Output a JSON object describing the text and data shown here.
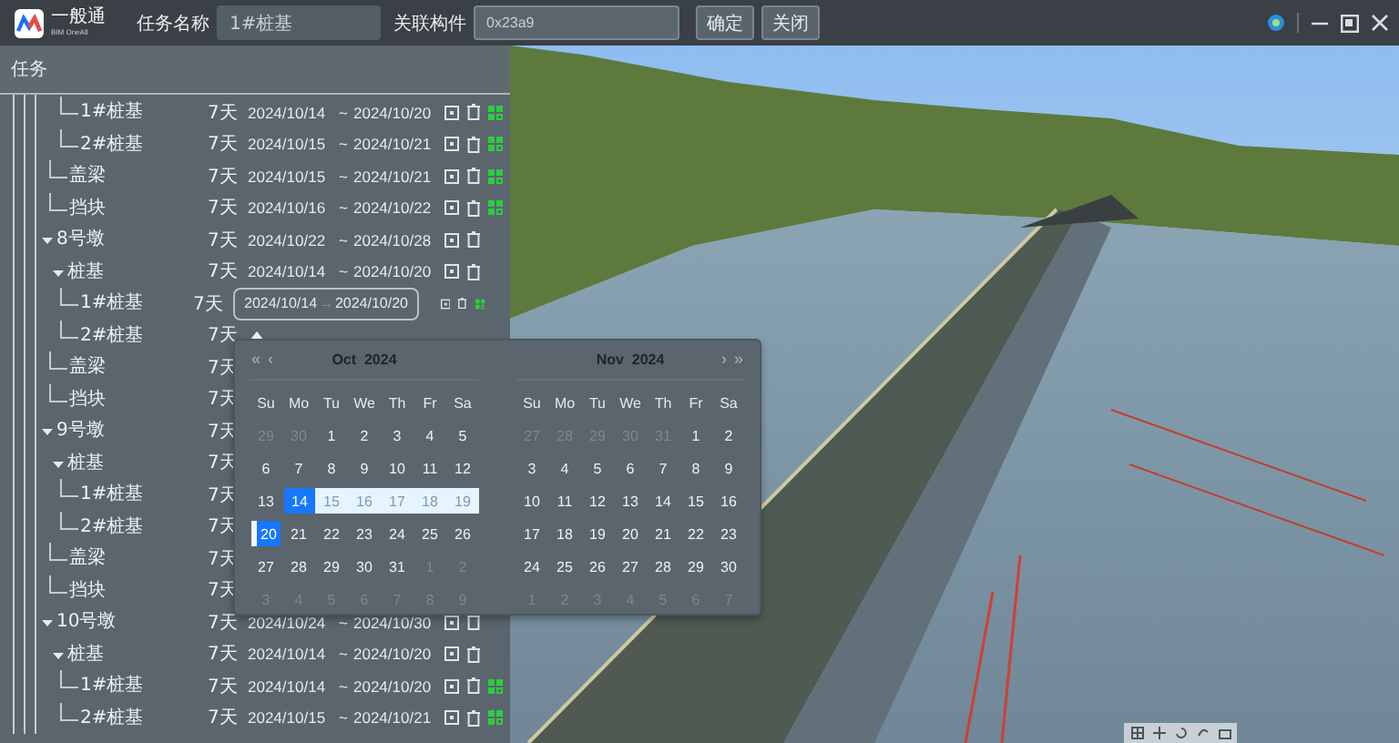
{
  "app": {
    "logo_text": "一般通",
    "logo_subtext": "BIM OneAll"
  },
  "toolbar": {
    "task_name_label": "任务名称",
    "task_name_value": "1#桩基",
    "component_label": "关联构件",
    "component_value": "0x23a9",
    "buttons": [
      "确定",
      "关闭"
    ]
  },
  "panel": {
    "title": "任务"
  },
  "tree": [
    {
      "children": [
        {
          "children": [
            {
              "label": "1#桩基",
              "duration": "7天",
              "start": "2024/10/14",
              "sep": "~",
              "end": "2024/10/20",
              "actions": true,
              "linked": true
            },
            {
              "label": "2#桩基",
              "duration": "7天",
              "start": "2024/10/15",
              "sep": "~",
              "end": "2024/10/21",
              "actions": true,
              "linked": true
            }
          ]
        },
        {
          "label": "盖梁",
          "duration": "7天",
          "start": "2024/10/15",
          "sep": "~",
          "end": "2024/10/21",
          "actions": true,
          "linked": true
        },
        {
          "label": "挡块",
          "duration": "7天",
          "start": "2024/10/16",
          "sep": "~",
          "end": "2024/10/22",
          "actions": true,
          "linked": true
        }
      ]
    },
    {
      "label": "8号墩",
      "expanded": true,
      "duration": "7天",
      "start": "2024/10/22",
      "sep": "~",
      "end": "2024/10/28",
      "actions": true,
      "linked": false,
      "children": [
        {
          "label": "桩基",
          "expanded": true,
          "duration": "7天",
          "start": "2024/10/14",
          "sep": "~",
          "end": "2024/10/20",
          "actions": true,
          "linked": false,
          "children": [
            {
              "label": "1#桩基",
              "duration": "7天",
              "date_range": {
                "start": "2024/10/14",
                "separator": "→",
                "end": "2024/10/20"
              },
              "actions": true,
              "linked": true
            },
            {
              "label": "2#桩基",
              "duration": "7天"
            }
          ]
        },
        {
          "label": "盖梁",
          "duration": "7天"
        },
        {
          "label": "挡块",
          "duration": "7天"
        }
      ]
    },
    {
      "label": "9号墩",
      "expanded": true,
      "duration": "7天",
      "children": [
        {
          "label": "桩基",
          "expanded": true,
          "duration": "7天",
          "children": [
            {
              "label": "1#桩基",
              "duration": "7天"
            },
            {
              "label": "2#桩基",
              "duration": "7天"
            }
          ]
        },
        {
          "label": "盖梁",
          "duration": "7天"
        },
        {
          "label": "挡块",
          "duration": "7天"
        }
      ]
    },
    {
      "label": "10号墩",
      "expanded": true,
      "duration": "7天",
      "start": "2024/10/24",
      "sep": "~",
      "end": "2024/10/30",
      "actions": true,
      "linked": false,
      "children": [
        {
          "label": "桩基",
          "expanded": true,
          "duration": "7天",
          "start": "2024/10/14",
          "sep": "~",
          "end": "2024/10/20",
          "actions": true,
          "linked": false,
          "children": [
            {
              "label": "1#桩基",
              "duration": "7天",
              "start": "2024/10/14",
              "sep": "~",
              "end": "2024/10/20",
              "actions": true,
              "linked": true
            },
            {
              "label": "2#桩基",
              "duration": "7天",
              "start": "2024/10/15",
              "sep": "~",
              "end": "2024/10/21",
              "actions": true,
              "linked": true
            }
          ]
        }
      ]
    }
  ],
  "date_picker": {
    "nav_prev": [
      "«",
      "‹"
    ],
    "nav_next": [
      "›",
      "»"
    ],
    "calendars": [
      {
        "title": "Oct  2024",
        "weekdays": [
          "Su",
          "Mo",
          "Tu",
          "We",
          "Th",
          "Fr",
          "Sa"
        ],
        "days": [
          {
            "day": "29",
            "kind": "other"
          },
          {
            "day": "30",
            "kind": "other"
          },
          {
            "day": "1",
            "kind": "normal"
          },
          {
            "day": "2",
            "kind": "normal"
          },
          {
            "day": "3",
            "kind": "normal"
          },
          {
            "day": "4",
            "kind": "normal"
          },
          {
            "day": "5",
            "kind": "normal"
          },
          {
            "day": "6",
            "kind": "normal"
          },
          {
            "day": "7",
            "kind": "normal"
          },
          {
            "day": "8",
            "kind": "normal"
          },
          {
            "day": "9",
            "kind": "normal"
          },
          {
            "day": "10",
            "kind": "normal"
          },
          {
            "day": "11",
            "kind": "normal"
          },
          {
            "day": "12",
            "kind": "normal"
          },
          {
            "day": "13",
            "kind": "normal"
          },
          {
            "day": "14",
            "kind": "start"
          },
          {
            "day": "15",
            "kind": "range"
          },
          {
            "day": "16",
            "kind": "range"
          },
          {
            "day": "17",
            "kind": "range"
          },
          {
            "day": "18",
            "kind": "range"
          },
          {
            "day": "19",
            "kind": "range"
          },
          {
            "day": "20",
            "kind": "end"
          },
          {
            "day": "21",
            "kind": "normal"
          },
          {
            "day": "22",
            "kind": "normal"
          },
          {
            "day": "23",
            "kind": "normal"
          },
          {
            "day": "24",
            "kind": "normal"
          },
          {
            "day": "25",
            "kind": "normal"
          },
          {
            "day": "26",
            "kind": "normal"
          },
          {
            "day": "27",
            "kind": "normal"
          },
          {
            "day": "28",
            "kind": "normal"
          },
          {
            "day": "29",
            "kind": "normal"
          },
          {
            "day": "30",
            "kind": "normal"
          },
          {
            "day": "31",
            "kind": "normal"
          },
          {
            "day": "1",
            "kind": "other"
          },
          {
            "day": "2",
            "kind": "other"
          },
          {
            "day": "3",
            "kind": "other"
          },
          {
            "day": "4",
            "kind": "other"
          },
          {
            "day": "5",
            "kind": "other"
          },
          {
            "day": "6",
            "kind": "other"
          },
          {
            "day": "7",
            "kind": "other"
          },
          {
            "day": "8",
            "kind": "other"
          },
          {
            "day": "9",
            "kind": "other"
          }
        ]
      },
      {
        "title": "Nov  2024",
        "weekdays": [
          "Su",
          "Mo",
          "Tu",
          "We",
          "Th",
          "Fr",
          "Sa"
        ],
        "days": [
          {
            "day": "27",
            "kind": "other"
          },
          {
            "day": "28",
            "kind": "other"
          },
          {
            "day": "29",
            "kind": "other"
          },
          {
            "day": "30",
            "kind": "other"
          },
          {
            "day": "31",
            "kind": "other"
          },
          {
            "day": "1",
            "kind": "normal"
          },
          {
            "day": "2",
            "kind": "normal"
          },
          {
            "day": "3",
            "kind": "normal"
          },
          {
            "day": "4",
            "kind": "normal"
          },
          {
            "day": "5",
            "kind": "normal"
          },
          {
            "day": "6",
            "kind": "normal"
          },
          {
            "day": "7",
            "kind": "normal"
          },
          {
            "day": "8",
            "kind": "normal"
          },
          {
            "day": "9",
            "kind": "normal"
          },
          {
            "day": "10",
            "kind": "normal"
          },
          {
            "day": "11",
            "kind": "normal"
          },
          {
            "day": "12",
            "kind": "normal"
          },
          {
            "day": "13",
            "kind": "normal"
          },
          {
            "day": "14",
            "kind": "normal"
          },
          {
            "day": "15",
            "kind": "normal"
          },
          {
            "day": "16",
            "kind": "normal"
          },
          {
            "day": "17",
            "kind": "normal"
          },
          {
            "day": "18",
            "kind": "normal"
          },
          {
            "day": "19",
            "kind": "normal"
          },
          {
            "day": "20",
            "kind": "normal"
          },
          {
            "day": "21",
            "kind": "normal"
          },
          {
            "day": "22",
            "kind": "normal"
          },
          {
            "day": "23",
            "kind": "normal"
          },
          {
            "day": "24",
            "kind": "normal"
          },
          {
            "day": "25",
            "kind": "normal"
          },
          {
            "day": "26",
            "kind": "normal"
          },
          {
            "day": "27",
            "kind": "normal"
          },
          {
            "day": "28",
            "kind": "normal"
          },
          {
            "day": "29",
            "kind": "normal"
          },
          {
            "day": "30",
            "kind": "normal"
          },
          {
            "day": "1",
            "kind": "other"
          },
          {
            "day": "2",
            "kind": "other"
          },
          {
            "day": "3",
            "kind": "other"
          },
          {
            "day": "4",
            "kind": "other"
          },
          {
            "day": "5",
            "kind": "other"
          },
          {
            "day": "6",
            "kind": "other"
          },
          {
            "day": "7",
            "kind": "other"
          }
        ]
      }
    ]
  }
}
